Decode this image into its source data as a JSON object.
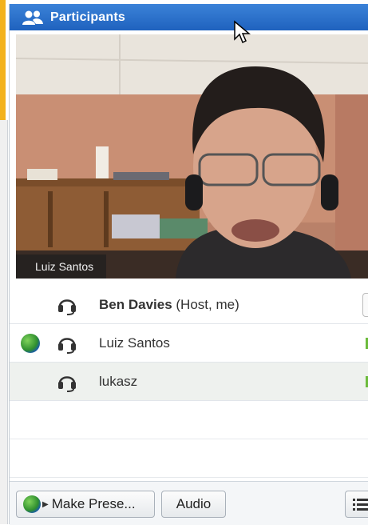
{
  "panel": {
    "title": "Participants",
    "title_icon": "participants-icon"
  },
  "video": {
    "label": "Luiz Santos"
  },
  "participants": [
    {
      "name": "Ben Davies",
      "role": " (Host, me)",
      "status_icon": "none",
      "audio_icon": "headset-icon"
    },
    {
      "name": "Luiz Santos",
      "role": "",
      "status_icon": "presenter-globe-icon",
      "audio_icon": "headset-icon"
    },
    {
      "name": "lukasz",
      "role": "",
      "status_icon": "none",
      "audio_icon": "headset-icon"
    }
  ],
  "buttons": {
    "make_presenter": "Make Prese...",
    "audio": "Audio",
    "list_icon": "list-icon"
  },
  "colors": {
    "title_bar": "#1f62be",
    "accent": "#f3b21c"
  }
}
